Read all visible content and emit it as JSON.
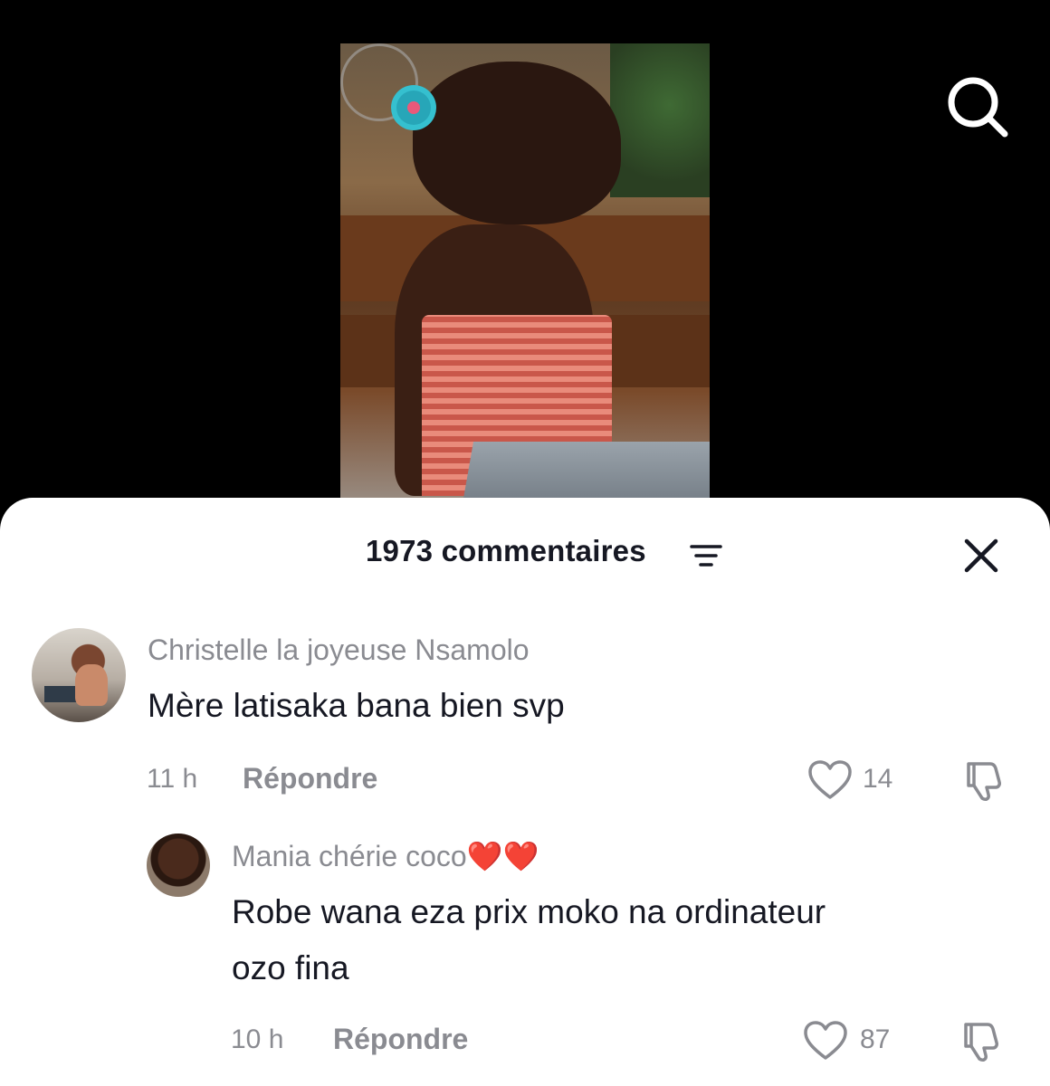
{
  "icons": {
    "search": "search-icon",
    "sort": "sort-icon",
    "close": "close-icon",
    "like": "heart-icon",
    "dislike": "thumbs-down-icon"
  },
  "sheet": {
    "title": "1973 commentaires"
  },
  "comments": [
    {
      "author": "Christelle la joyeuse Nsamolo",
      "text": "Mère latisaka bana bien svp",
      "time": "11 h",
      "reply_label": "Répondre",
      "likes": "14"
    },
    {
      "author": "Mania chérie coco",
      "author_emoji": "❤️❤️",
      "text_line1": "Robe wana eza prix moko na ordinateur",
      "text_line2": "ozo fina",
      "time": "10 h",
      "reply_label": "Répondre",
      "likes": "87"
    }
  ]
}
